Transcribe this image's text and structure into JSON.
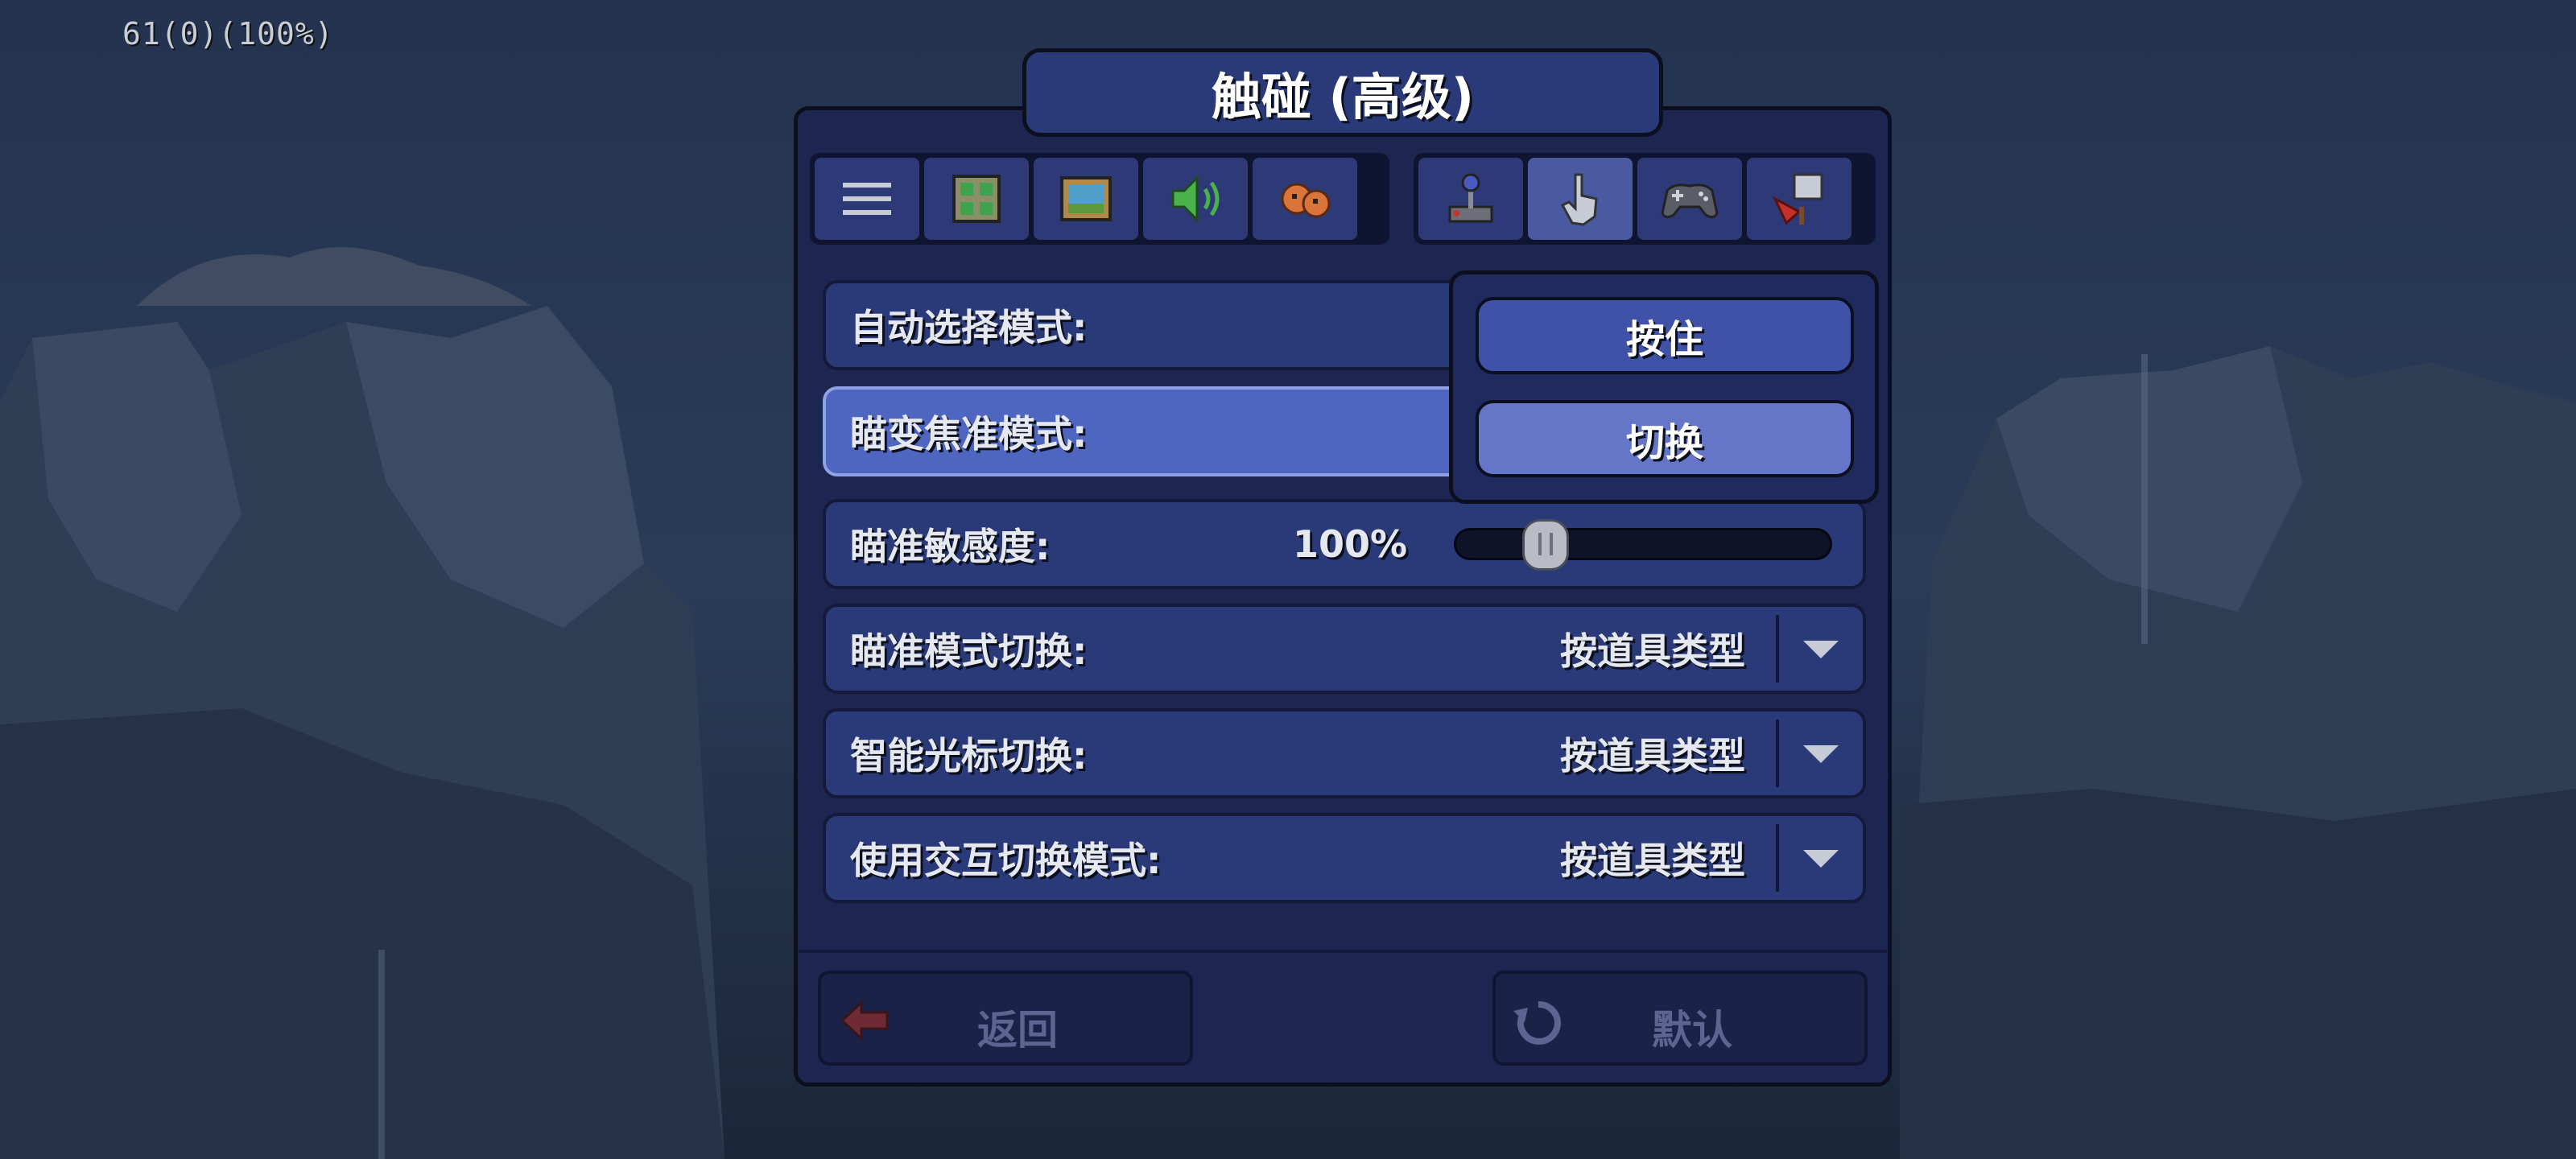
{
  "status": {
    "fps": "61(0)(100%)"
  },
  "window": {
    "title": "触碰 (高级)"
  },
  "tabs": [
    {
      "icon": "menu-icon"
    },
    {
      "icon": "interface-icon"
    },
    {
      "icon": "video-icon"
    },
    {
      "icon": "audio-icon"
    },
    {
      "icon": "cursor-icon"
    },
    {
      "icon": "joystick-icon"
    },
    {
      "icon": "touch-hand-icon"
    },
    {
      "icon": "gamepad-icon"
    },
    {
      "icon": "feedback-icon"
    }
  ],
  "settings": {
    "auto_select": {
      "label": "自动选择模式:"
    },
    "aim_focus": {
      "label": "瞄变焦准模式:"
    },
    "aim_sensitivity": {
      "label": "瞄准敏感度:",
      "value": "100%",
      "fraction": 0.24
    },
    "aim_mode_toggle": {
      "label": "瞄准模式切换:",
      "value": "按道具类型"
    },
    "smart_cursor_toggle": {
      "label": "智能光标切换:",
      "value": "按道具类型"
    },
    "interact_toggle": {
      "label": "使用交互切换模式:",
      "value": "按道具类型"
    }
  },
  "popup": {
    "options": [
      "按住",
      "切换"
    ],
    "selected": "切换"
  },
  "footer": {
    "back_label": "返回",
    "default_label": "默认"
  },
  "colors": {
    "panel": "#1c2651",
    "row": "#2a3a78",
    "highlight": "#4f66c0",
    "accent_red": "#c2312b"
  }
}
